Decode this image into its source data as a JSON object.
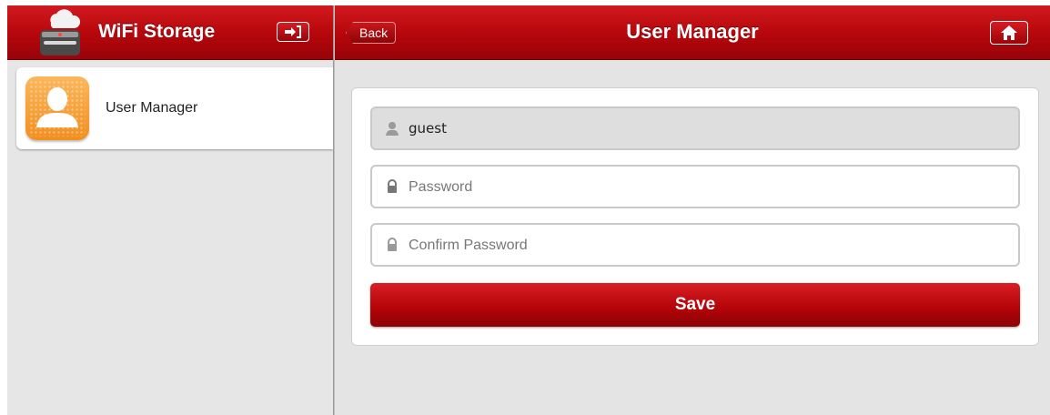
{
  "app": {
    "title": "WiFi Storage",
    "brand_icon": "cloud-drive-icon",
    "exit_icon": "exit-icon"
  },
  "sidebar": {
    "items": [
      {
        "label": "User Manager",
        "icon": "user-manager-icon"
      }
    ]
  },
  "header": {
    "back_label": "Back",
    "title": "User Manager",
    "home_icon": "home-icon"
  },
  "form": {
    "username": {
      "value": "guest",
      "icon": "user-icon"
    },
    "password": {
      "placeholder": "Password",
      "value": "",
      "icon": "lock-icon"
    },
    "confirm_password": {
      "placeholder": "Confirm Password",
      "value": "",
      "icon": "lock-icon"
    },
    "save_label": "Save"
  },
  "colors": {
    "accent": "#b5060b",
    "accent_dark": "#8c0206",
    "orange": "#f39a2b"
  }
}
